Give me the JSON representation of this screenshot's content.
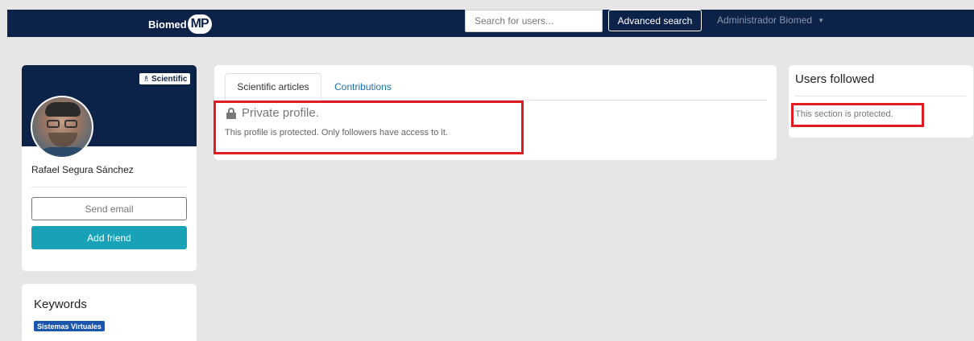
{
  "header": {
    "brand_text": "Biomed",
    "brand_badge": "MP",
    "search_placeholder": "Search for users...",
    "advanced_search_label": "Advanced search",
    "user_menu_label": "Administrador Biomed",
    "caret_glyph": "▼"
  },
  "profile": {
    "badge_label": "Scientific",
    "badge_icon": "microscope-icon",
    "name": "Rafael Segura Sánchez",
    "send_email_label": "Send email",
    "add_friend_label": "Add friend"
  },
  "keywords": {
    "title": "Keywords",
    "tags": [
      "Sistemas Virtuales"
    ]
  },
  "main": {
    "tabs": [
      {
        "label": "Scientific articles",
        "active": true
      },
      {
        "label": "Contributions",
        "active": false
      }
    ],
    "private_title": "Private profile.",
    "private_desc": "This profile is protected. Only followers have access to it."
  },
  "following": {
    "title": "Users followed",
    "desc": "This section is protected."
  },
  "colors": {
    "navbar": "#0d2248",
    "accent_button": "#17a2b8",
    "tab_link": "#1a6fb0",
    "keyword_tag": "#1a56b0",
    "highlight": "#e01b22",
    "page_bg": "#e6e6e6"
  }
}
